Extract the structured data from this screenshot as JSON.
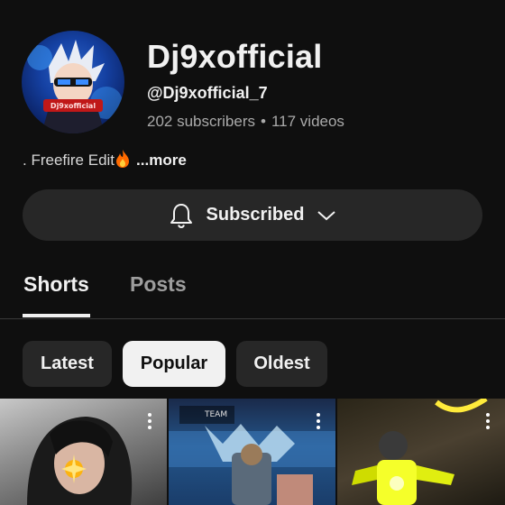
{
  "channel": {
    "name": "Dj9xofficial",
    "handle": "@Dj9xofficial_7",
    "subscribers": "202 subscribers",
    "separator": "•",
    "videos": "117 videos",
    "avatar_text": "Dj9xofficial"
  },
  "description": {
    "text": ". Freefire Edit",
    "emoji_icon": "fire-icon",
    "more_label": "...more"
  },
  "subscribe": {
    "label": "Subscribed",
    "icon": "bell-icon",
    "dropdown_icon": "chevron-down-icon"
  },
  "tabs": [
    {
      "label": "Shorts",
      "active": true
    },
    {
      "label": "Posts",
      "active": false
    }
  ],
  "chips": [
    {
      "label": "Latest",
      "selected": false
    },
    {
      "label": "Popular",
      "selected": true
    },
    {
      "label": "Oldest",
      "selected": false
    }
  ],
  "thumbnails": [
    {
      "overlay_text": ""
    },
    {
      "overlay_text": "TEAM"
    },
    {
      "overlay_text": ""
    }
  ],
  "colors": {
    "background": "#0f0f0f",
    "surface": "#272727",
    "text": "#f1f1f1",
    "muted": "#aaaaaa"
  }
}
